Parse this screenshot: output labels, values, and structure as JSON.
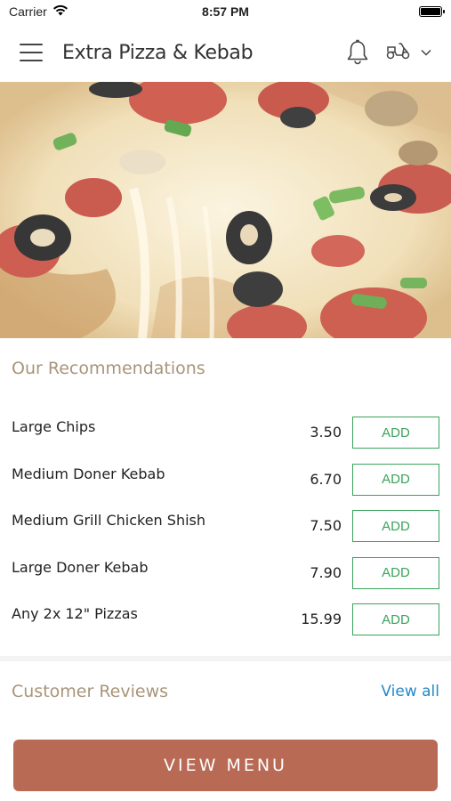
{
  "status_bar": {
    "carrier": "Carrier",
    "time": "8:57 PM"
  },
  "header": {
    "title": "Extra Pizza & Kebab",
    "icons": [
      "menu-icon",
      "bell-icon",
      "scooter-icon",
      "chevron-down-icon"
    ]
  },
  "recommendations": {
    "title": "Our Recommendations",
    "items": [
      {
        "name": "Large Chips",
        "price": "3.50",
        "button": "ADD"
      },
      {
        "name": "Medium Doner Kebab",
        "price": "6.70",
        "button": "ADD"
      },
      {
        "name": "Medium Grill Chicken Shish",
        "price": "7.50",
        "button": "ADD"
      },
      {
        "name": "Large Doner Kebab",
        "price": "7.90",
        "button": "ADD"
      },
      {
        "name": "Any 2x 12\" Pizzas",
        "price": "15.99",
        "button": "ADD"
      }
    ]
  },
  "reviews": {
    "title": "Customer Reviews",
    "view_all": "View all"
  },
  "view_menu_button": "VIEW MENU",
  "colors": {
    "section_title": "#a8957a",
    "add_button": "#3aa35b",
    "link": "#2389c9",
    "primary_button": "#b86a55"
  }
}
